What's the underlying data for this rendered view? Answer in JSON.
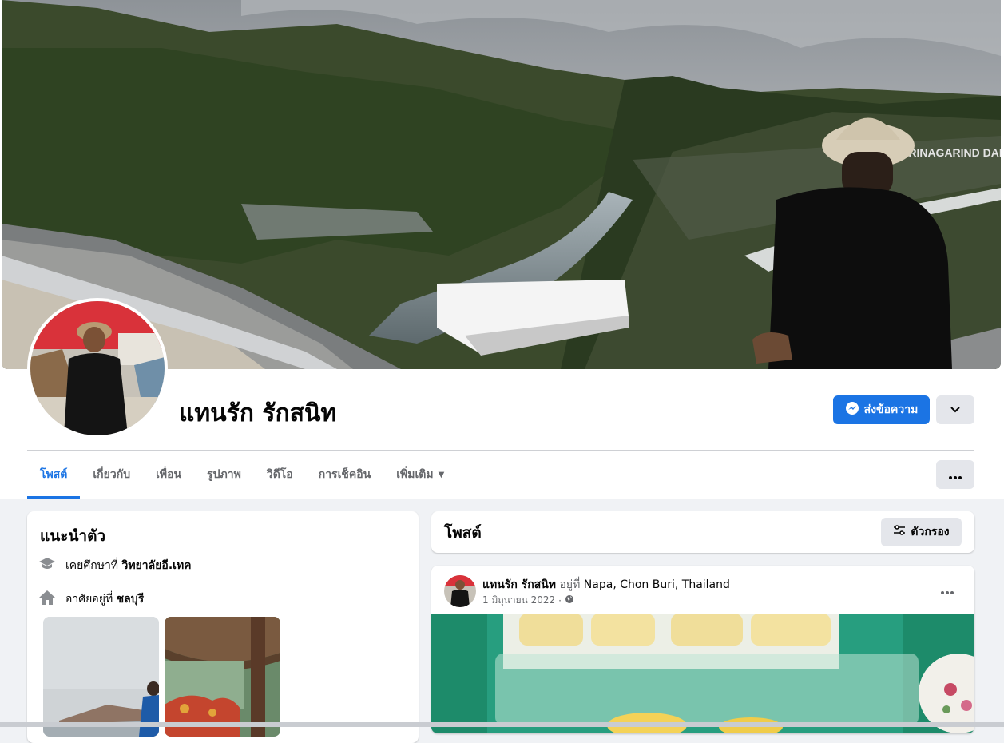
{
  "profile": {
    "name": "แทนรัก รักสนิท",
    "message_label": "ส่งข้อความ"
  },
  "tabs": [
    {
      "label": "โพสต์",
      "active": true
    },
    {
      "label": "เกี่ยวกับ"
    },
    {
      "label": "เพื่อน"
    },
    {
      "label": "รูปภาพ"
    },
    {
      "label": "วิดีโอ"
    },
    {
      "label": "การเช็คอิน"
    },
    {
      "label": "เพิ่มเติม"
    }
  ],
  "intro": {
    "title": "แนะนำตัว",
    "education_prefix": "เคยศึกษาที่",
    "education_value": "วิทยาลัยอี.เทค",
    "residence_prefix": "อาศัยอยู่ที่",
    "residence_value": "ชลบุรี"
  },
  "posts": {
    "title": "โพสต์",
    "filter_label": "ตัวกรอง"
  },
  "post": {
    "author": "แทนรัก รักสนิท",
    "at_text": "อยู่ที่",
    "location": "Napa, Chon Buri, Thailand",
    "date": "1 มิถุนายน 2022",
    "separator": "·"
  },
  "cover_sign_text": "SRINAGARIND DAM",
  "colors": {
    "accent": "#1b74e4",
    "button_gray": "#e4e6eb",
    "page_bg": "#f0f2f5",
    "secondary_text": "#65676b"
  },
  "icons": [
    "messenger-icon",
    "chevron-down-icon",
    "more-icon",
    "graduation-cap-icon",
    "home-icon",
    "filter-icon",
    "globe-icon",
    "caret-down-icon"
  ]
}
